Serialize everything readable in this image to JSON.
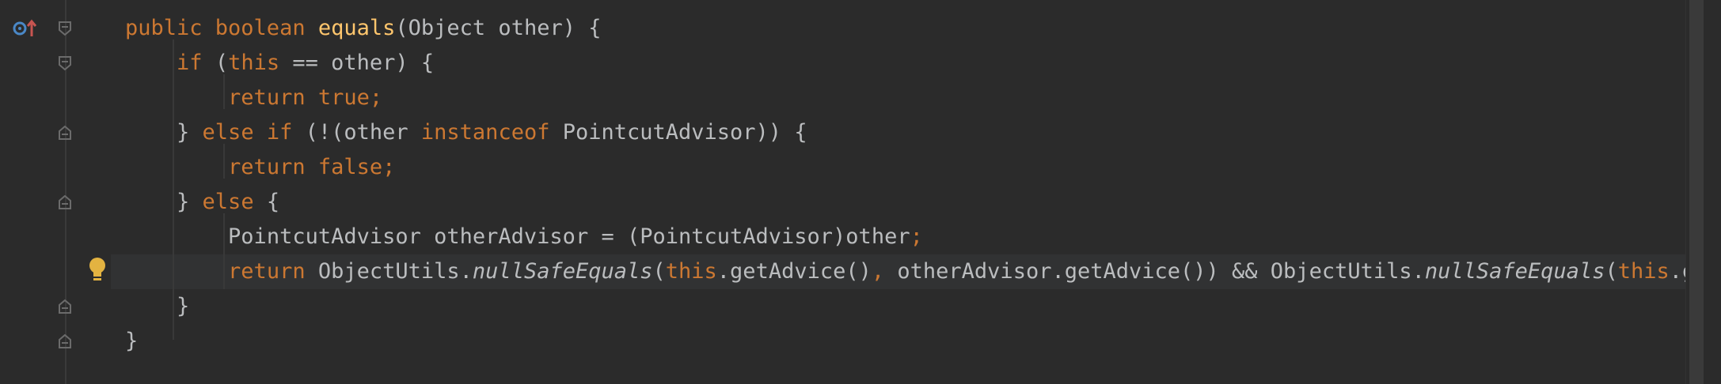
{
  "code": {
    "lines": [
      {
        "indent": "",
        "segs": [
          {
            "t": "public boolean ",
            "c": "kw"
          },
          {
            "t": "equals",
            "c": "fn"
          },
          {
            "t": "(Object other) {",
            "c": ""
          }
        ]
      },
      {
        "indent": "    ",
        "segs": [
          {
            "t": "if ",
            "c": "kw"
          },
          {
            "t": "(",
            "c": ""
          },
          {
            "t": "this ",
            "c": "kw"
          },
          {
            "t": "== other) {",
            "c": ""
          }
        ]
      },
      {
        "indent": "        ",
        "segs": [
          {
            "t": "return true;",
            "c": "kw"
          }
        ]
      },
      {
        "indent": "    ",
        "segs": [
          {
            "t": "} ",
            "c": ""
          },
          {
            "t": "else if ",
            "c": "kw"
          },
          {
            "t": "(!(other ",
            "c": ""
          },
          {
            "t": "instanceof ",
            "c": "kw"
          },
          {
            "t": "PointcutAdvisor)) {",
            "c": ""
          }
        ]
      },
      {
        "indent": "        ",
        "segs": [
          {
            "t": "return false;",
            "c": "kw"
          }
        ]
      },
      {
        "indent": "    ",
        "segs": [
          {
            "t": "} ",
            "c": ""
          },
          {
            "t": "else ",
            "c": "kw"
          },
          {
            "t": "{",
            "c": ""
          }
        ]
      },
      {
        "indent": "        ",
        "segs": [
          {
            "t": "PointcutAdvisor otherAdvisor = (PointcutAdvisor)other",
            "c": ""
          },
          {
            "t": ";",
            "c": "kw"
          }
        ]
      },
      {
        "indent": "        ",
        "segs": [
          {
            "t": "return ",
            "c": "kw"
          },
          {
            "t": "ObjectUtils.",
            "c": ""
          },
          {
            "t": "nullSafeEquals",
            "c": "it"
          },
          {
            "t": "(",
            "c": ""
          },
          {
            "t": "this",
            "c": "kw"
          },
          {
            "t": ".getAdvice()",
            "c": ""
          },
          {
            "t": ", ",
            "c": "kw"
          },
          {
            "t": "otherAdvisor.getAdvice()) && ObjectUtils.",
            "c": ""
          },
          {
            "t": "nullSafeEquals",
            "c": "it"
          },
          {
            "t": "(",
            "c": ""
          },
          {
            "t": "this",
            "c": "kw"
          },
          {
            "t": ".getP",
            "c": ""
          }
        ]
      },
      {
        "indent": "    ",
        "segs": [
          {
            "t": "}",
            "c": ""
          }
        ]
      },
      {
        "indent": "",
        "segs": [
          {
            "t": "}",
            "c": ""
          }
        ]
      }
    ]
  },
  "gutter": {
    "icons": [
      "override-method-icon",
      "intention-bulb-icon"
    ]
  },
  "colors": {
    "background": "#2b2b2b",
    "keyword": "#cc7832",
    "method": "#ffc66d",
    "text": "#bbbdbf",
    "caret_row": "#313233"
  }
}
